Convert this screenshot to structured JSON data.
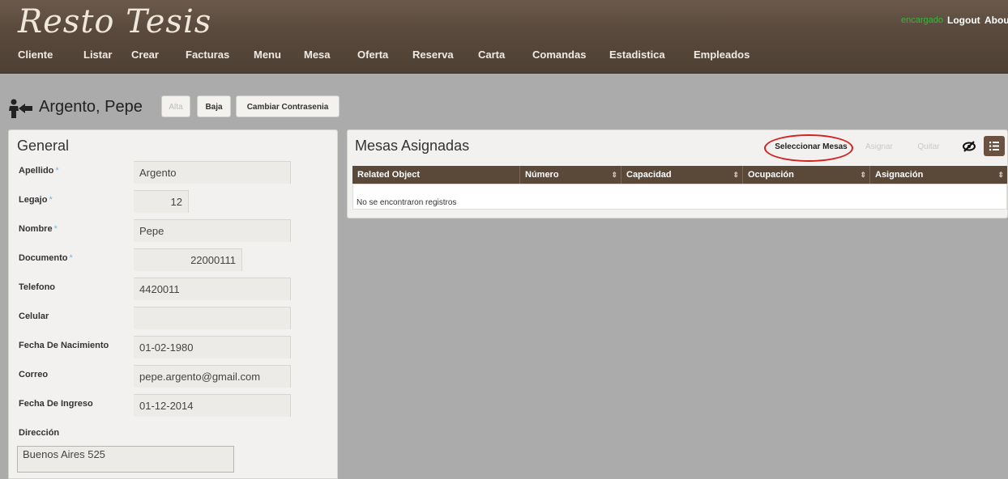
{
  "app": {
    "logo": "Resto Tesis",
    "nav": [
      "Cliente",
      "Listar",
      "Crear",
      "Facturas",
      "Menu",
      "Mesa",
      "Oferta",
      "Reserva",
      "Carta",
      "Comandas",
      "Estadistica",
      "Empleados"
    ],
    "user": "encargado",
    "logout": "Logout",
    "about": "About"
  },
  "entity": {
    "title": "Argento, Pepe",
    "buttons": {
      "alta": "Alta",
      "baja": "Baja",
      "cambiar": "Cambiar Contrasenia"
    }
  },
  "general": {
    "title": "General",
    "required_marker": "*",
    "fields": [
      {
        "label": "Apellido",
        "value": "Argento"
      },
      {
        "label": "Legajo",
        "value": "12"
      },
      {
        "label": "Nombre",
        "value": "Pepe"
      },
      {
        "label": "Documento",
        "value": "22000111"
      },
      {
        "label": "Telefono",
        "value": "4420011"
      },
      {
        "label": "Celular",
        "value": ""
      },
      {
        "label": "Fecha De Nacimiento",
        "value": "01-02-1980"
      },
      {
        "label": "Correo",
        "value": "pepe.argento@gmail.com"
      },
      {
        "label": "Fecha De Ingreso",
        "value": "01-12-2014"
      },
      {
        "label": "Dirección",
        "value": "Buenos Aires 525"
      }
    ]
  },
  "mesas": {
    "title": "Mesas Asignadas",
    "buttons": {
      "seleccionar": "Seleccionar Mesas",
      "asignar": "Asignar",
      "quitar": "Quitar"
    },
    "columns": [
      "Related Object",
      "Número",
      "Capacidad",
      "Ocupación",
      "Asignación"
    ],
    "empty_text": "No se encontraron registros",
    "sort_glyph": "⇕"
  },
  "colors": {
    "header_brown": "#5a4a3d",
    "grid_header": "#5a4838",
    "highlight_circle": "#d52020",
    "user_green": "#3ab53a"
  }
}
